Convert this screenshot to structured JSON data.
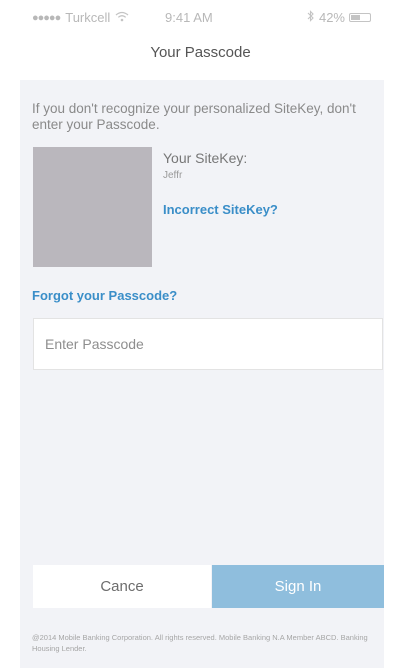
{
  "status_bar": {
    "signal_dots": "●●●●●",
    "carrier": "Turkcell",
    "wifi_icon": "wifi-icon",
    "time": "9:41 AM",
    "bluetooth_icon": "bluetooth-icon",
    "battery_percent": "42%"
  },
  "header": {
    "title": "Your Passcode"
  },
  "main": {
    "warning_text": "If you don't recognize your personalized SiteKey, don't enter your Passcode.",
    "sitekey_heading": "Your SiteKey:",
    "sitekey_value": "Jeffr",
    "incorrect_link": "Incorrect SiteKey?",
    "forgot_link": "Forgot your Passcode?",
    "passcode_placeholder": "Enter Passcode"
  },
  "actions": {
    "cancel_label": "Cance",
    "signin_label": "Sign In"
  },
  "footer": {
    "text": "@2014 Mobile Banking Corporation. All rights reserved. Mobile Banking N.A Member ABCD. Banking Housing Lender."
  },
  "colors": {
    "link": "#3a8ec8",
    "primary_button": "#8fbedd",
    "panel_background": "#f2f3f7"
  }
}
